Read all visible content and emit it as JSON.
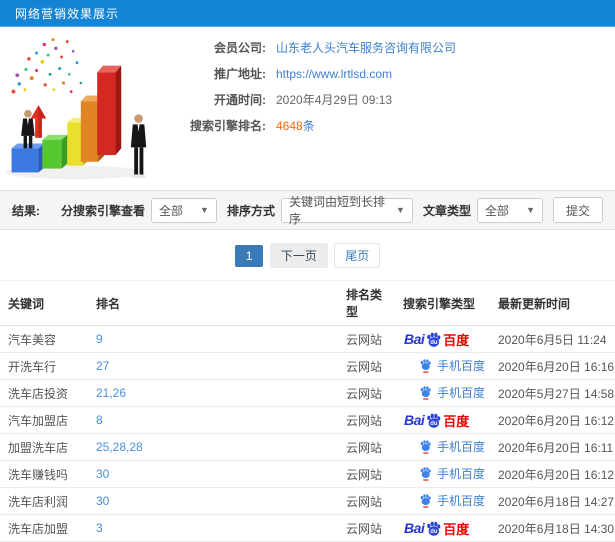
{
  "header": {
    "title": "网络营销效果展示"
  },
  "info": {
    "rows": [
      {
        "label": "会员公司:",
        "value": "山东老人头汽车服务咨询有限公司"
      },
      {
        "label": "推广地址:",
        "value": "https://www.lrtlsd.com"
      },
      {
        "label": "开通时间:",
        "value": "2020年4月29日 09:13"
      },
      {
        "label": "搜索引擎排名:",
        "value": "4648",
        "suffix": "条"
      }
    ]
  },
  "filters": {
    "result_label": "结果:",
    "engine_label": "分搜索引擎查看",
    "engine_value": "全部",
    "sort_label": "排序方式",
    "sort_value": "关键词由短到长排序",
    "article_label": "文章类型",
    "article_value": "全部",
    "submit_label": "提交"
  },
  "pagination": {
    "current": "1",
    "next": "下一页",
    "last": "尾页"
  },
  "table": {
    "headers": [
      "关键词",
      "排名",
      "排名类型",
      "搜索引擎类型",
      "最新更新时间"
    ],
    "rows": [
      {
        "keyword": "汽车美容",
        "rank": "9",
        "rank_type": "云网站",
        "engine": "baidu_pc",
        "updated": "2020年6月5日 11:24"
      },
      {
        "keyword": "开洗车行",
        "rank": "27",
        "rank_type": "云网站",
        "engine": "baidu_mobile",
        "updated": "2020年6月20日 16:16"
      },
      {
        "keyword": "洗车店投资",
        "rank": "21,26",
        "rank_type": "云网站",
        "engine": "baidu_mobile",
        "updated": "2020年5月27日 14:58"
      },
      {
        "keyword": "汽车加盟店",
        "rank": "8",
        "rank_type": "云网站",
        "engine": "baidu_pc",
        "updated": "2020年6月20日 16:12"
      },
      {
        "keyword": "加盟洗车店",
        "rank": "25,28,28",
        "rank_type": "云网站",
        "engine": "baidu_mobile",
        "updated": "2020年6月20日 16:11"
      },
      {
        "keyword": "洗车赚钱吗",
        "rank": "30",
        "rank_type": "云网站",
        "engine": "baidu_mobile",
        "updated": "2020年6月20日 16:12"
      },
      {
        "keyword": "洗车店利润",
        "rank": "30",
        "rank_type": "云网站",
        "engine": "baidu_mobile",
        "updated": "2020年6月18日 14:27"
      },
      {
        "keyword": "洗车店加盟",
        "rank": "3",
        "rank_type": "云网站",
        "engine": "baidu_pc",
        "updated": "2020年6月18日 14:30"
      }
    ]
  },
  "engine_branding": {
    "baidu_pc": {
      "bai": "Bai",
      "du": "du",
      "cn": "百度"
    },
    "baidu_mobile": {
      "label": "手机百度"
    }
  },
  "illustration": {
    "name": "3d-growth-bar-chart-with-businessmen",
    "bar_colors": [
      "#3b78e0",
      "#58c832",
      "#e8e02c",
      "#e08426",
      "#d42822"
    ]
  },
  "colors": {
    "topbar": "#1484d6",
    "link": "#3c7fd0",
    "highlight": "#ff6600",
    "pager_active": "#3a7ab8",
    "baidu_blue": "#2636d4",
    "baidu_red": "#e10601"
  }
}
